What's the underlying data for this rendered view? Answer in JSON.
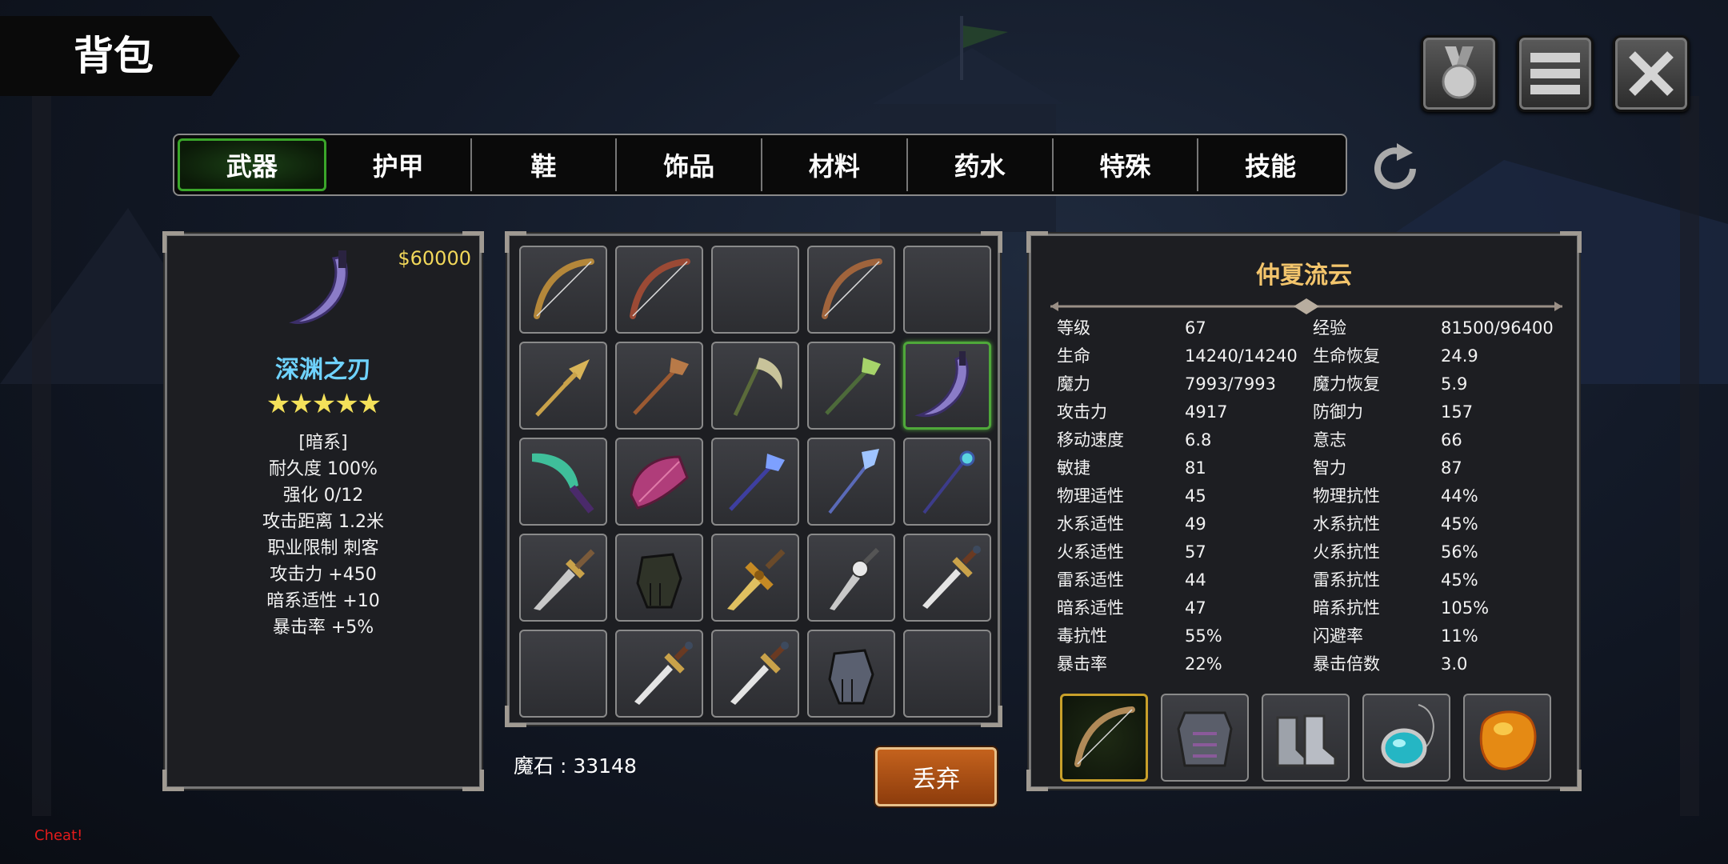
{
  "header": {
    "title": "背包"
  },
  "top_buttons": [
    {
      "name": "medal-button",
      "icon": "medal-icon"
    },
    {
      "name": "menu-button",
      "icon": "menu-icon"
    },
    {
      "name": "close-button",
      "icon": "close-icon"
    }
  ],
  "tabs": [
    "武器",
    "护甲",
    "鞋",
    "饰品",
    "材料",
    "药水",
    "特殊",
    "技能"
  ],
  "active_tab": "武器",
  "item_detail": {
    "price": "$60000",
    "name": "深渊之刃",
    "stars": "★★★★★",
    "star_count": 5,
    "attributes": [
      "[暗系]",
      "耐久度 100%",
      "强化 0/12",
      "攻击距离  1.2米",
      "职业限制  刺客",
      "攻击力  +450",
      "暗系适性  +10",
      "暴击率  +5%"
    ]
  },
  "inventory": {
    "slots": [
      "golden-bow-icon",
      "red-bow-icon",
      "empty",
      "wooden-bow-icon",
      "empty",
      "golden-trident-icon",
      "wooden-staff-icon",
      "bone-scythe-icon",
      "green-leaf-staff-icon",
      "dark-curved-blade-icon",
      "green-blade-icon",
      "crimson-shell-icon",
      "blue-spear-icon",
      "ice-trident-icon",
      "crystal-staff-icon",
      "ornate-dagger-icon",
      "dark-gauntlet-icon",
      "golden-sword-icon",
      "skull-dagger-icon",
      "bronze-sword-icon",
      "empty",
      "bronze-sword-icon",
      "bronze-sword-icon",
      "iron-gauntlet-icon",
      "empty"
    ],
    "selected_index": 9
  },
  "currency": {
    "label": "魔石 : 33148"
  },
  "drop_button": "丢弃",
  "character": {
    "name": "仲夏流云",
    "stats": [
      [
        "等级",
        "67",
        "经验",
        "81500/96400"
      ],
      [
        "生命",
        "14240/14240",
        "生命恢复",
        "24.9"
      ],
      [
        "魔力",
        "7993/7993",
        "魔力恢复",
        "5.9"
      ],
      [
        "攻击力",
        "4917",
        "防御力",
        "157"
      ],
      [
        "移动速度",
        "6.8",
        "意志",
        "66"
      ],
      [
        "敏捷",
        "81",
        "智力",
        "87"
      ],
      [
        "物理适性",
        "45",
        "物理抗性",
        "44%"
      ],
      [
        "水系适性",
        "49",
        "水系抗性",
        "45%"
      ],
      [
        "火系适性",
        "57",
        "火系抗性",
        "56%"
      ],
      [
        "雷系适性",
        "44",
        "雷系抗性",
        "45%"
      ],
      [
        "暗系适性",
        "47",
        "暗系抗性",
        "105%"
      ],
      [
        "毒抗性",
        "55%",
        "闪避率",
        "11%"
      ],
      [
        "暴击率",
        "22%",
        "暴击倍数",
        "3.0"
      ]
    ],
    "equipment": [
      "equipped-bow-icon",
      "chest-armor-icon",
      "steel-boots-icon",
      "turquoise-amulet-icon",
      "amber-stone-icon"
    ]
  },
  "cheat_label": "Cheat!",
  "colors": {
    "accent_green": "#3aa62a",
    "item_name": "#6fd3ff",
    "character_name": "#f3c56c",
    "price": "#f2d85a",
    "drop_button": "#b3521a",
    "cheat": "#e41b1b"
  }
}
